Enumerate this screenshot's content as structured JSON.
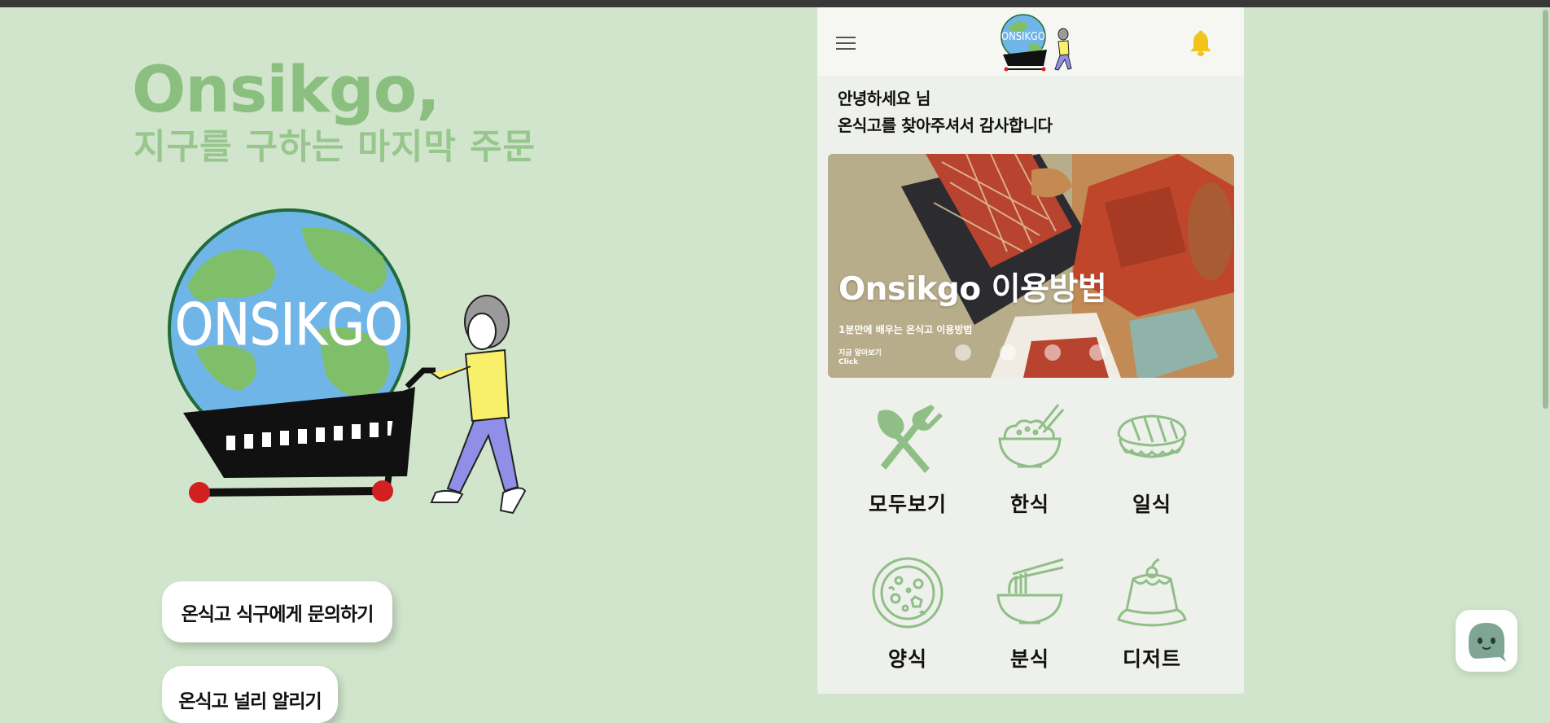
{
  "brand": {
    "title": "Onsikgo,",
    "subtitle": "지구를 구하는 마지막 주문",
    "illustration_text": "ONSIKGO"
  },
  "left_buttons": {
    "inquiry": "온식고 식구에게 문의하기",
    "promote": "온식고 널리 알리기"
  },
  "app": {
    "logo_text": "ONSIKGO",
    "greeting_line1": "안녕하세요 님",
    "greeting_line2": "온식고를 찾아주셔서 감사합니다",
    "banner": {
      "title": "Onsikgo 이용방법",
      "subtitle": "1분만에 배우는 온식고 이용방법",
      "link_line1": "지금 알아보기",
      "link_line2": "Click",
      "slide_count": 4
    },
    "categories": [
      {
        "label": "모두보기",
        "icon": "utensils-icon"
      },
      {
        "label": "한식",
        "icon": "rice-bowl-icon"
      },
      {
        "label": "일식",
        "icon": "sushi-icon"
      },
      {
        "label": "양식",
        "icon": "pizza-icon"
      },
      {
        "label": "분식",
        "icon": "noodle-bowl-icon"
      },
      {
        "label": "디저트",
        "icon": "pudding-icon"
      }
    ]
  },
  "colors": {
    "page_background": "#d0e5cb",
    "brand_green": "#8bbf80",
    "icon_green": "#8fbf86",
    "bell_yellow": "#f2c41b",
    "app_background": "#eef0ec"
  }
}
